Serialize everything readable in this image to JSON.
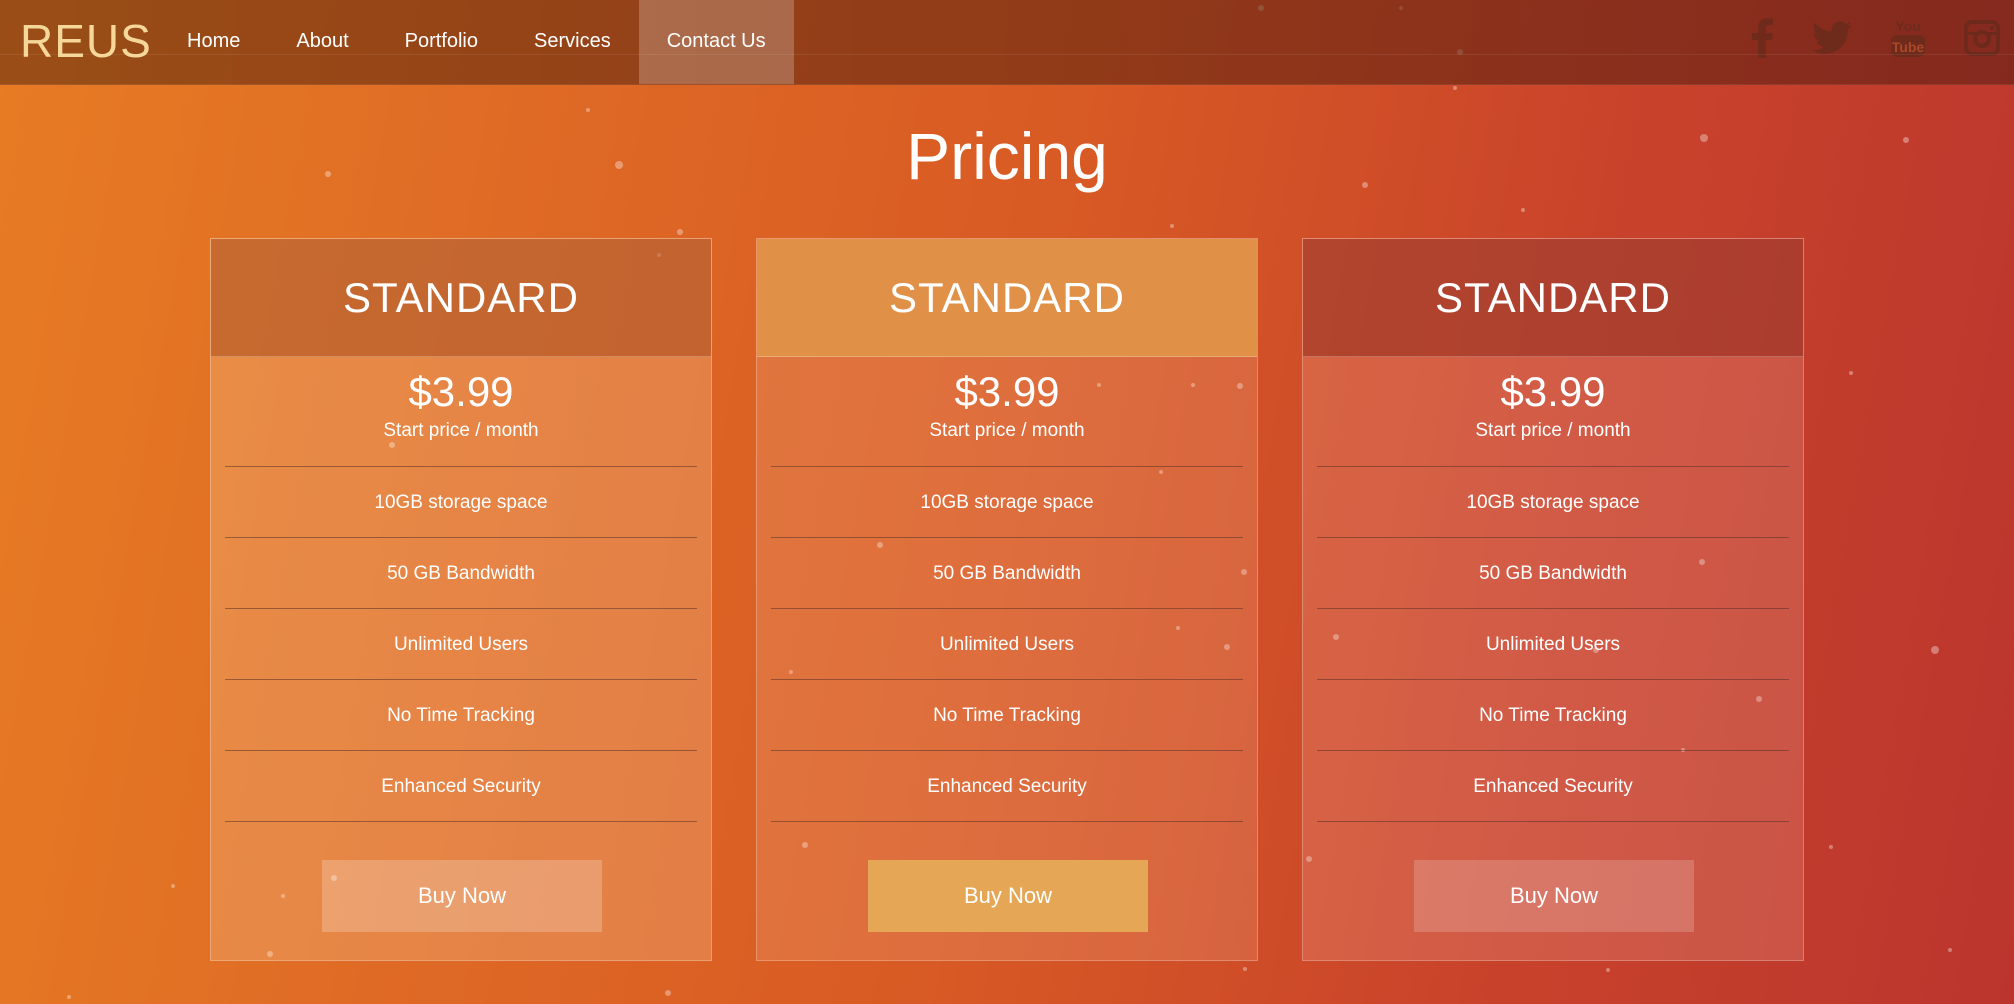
{
  "brand": "REUS",
  "nav": {
    "items": [
      {
        "label": "Home"
      },
      {
        "label": "About"
      },
      {
        "label": "Portfolio"
      },
      {
        "label": "Services"
      },
      {
        "label": "Contact Us",
        "active": true
      }
    ]
  },
  "social": {
    "icons": [
      "facebook-icon",
      "twitter-icon",
      "youtube-icon",
      "instagram-icon"
    ],
    "youtube_text_top": "You",
    "youtube_text_bottom": "Tube"
  },
  "page_title": "Pricing",
  "plans": [
    {
      "name": "STANDARD",
      "price": "$3.99",
      "price_sub": "Start price / month",
      "features": [
        "10GB storage space",
        "50 GB Bandwidth",
        "Unlimited Users",
        "No Time Tracking",
        "Enhanced Security"
      ],
      "button": "Buy Now"
    },
    {
      "name": "STANDARD",
      "price": "$3.99",
      "price_sub": "Start price / month",
      "features": [
        "10GB storage space",
        "50 GB Bandwidth",
        "Unlimited Users",
        "No Time Tracking",
        "Enhanced Security"
      ],
      "button": "Buy Now",
      "highlighted": true
    },
    {
      "name": "STANDARD",
      "price": "$3.99",
      "price_sub": "Start price / month",
      "features": [
        "10GB storage space",
        "50 GB Bandwidth",
        "Unlimited Users",
        "No Time Tracking",
        "Enhanced Security"
      ],
      "button": "Buy Now"
    }
  ],
  "colors": {
    "brand": "#f6d79a",
    "highlight_header": "#e19048",
    "highlight_button": "#e5a655",
    "background_start": "#e77c24",
    "background_end": "#bb352e"
  }
}
